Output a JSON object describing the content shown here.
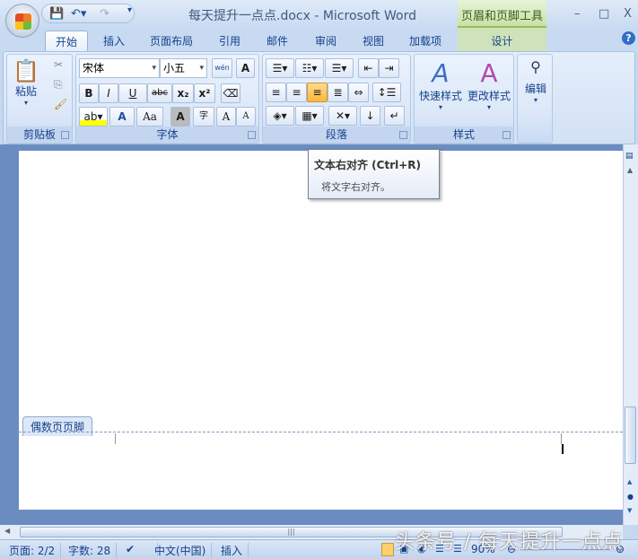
{
  "window": {
    "title": "每天提升一点点.docx - Microsoft Word",
    "context_title": "页眉和页脚工具",
    "minimize": "–",
    "maximize": "□",
    "close": "X"
  },
  "tabs": [
    "开始",
    "插入",
    "页面布局",
    "引用",
    "邮件",
    "审阅",
    "视图",
    "加载项"
  ],
  "context_tab": "设计",
  "help": "?",
  "ribbon": {
    "clipboard": {
      "label": "剪贴板",
      "paste": "粘贴"
    },
    "font": {
      "label": "字体",
      "font_name": "宋体",
      "font_size": "小五",
      "bold": "B",
      "italic": "I",
      "underline": "U",
      "strike": "abc",
      "sub": "x₂",
      "sup": "x²",
      "grow": "A",
      "shrink": "A",
      "case": "Aa",
      "shade": "A",
      "enclose": "字",
      "phonetic": "wén",
      "border": "A",
      "color": "A"
    },
    "paragraph": {
      "label": "段落"
    },
    "styles": {
      "label": "样式",
      "quick": "快速样式",
      "change": "更改样式"
    },
    "editing": {
      "label": "编辑"
    }
  },
  "tooltip": {
    "title": "文本右对齐 (Ctrl+R)",
    "body": "将文字右对齐。"
  },
  "document": {
    "footer_label": "偶数页页脚"
  },
  "status": {
    "page": "页面: 2/2",
    "words": "字数: 28",
    "language": "中文(中国)",
    "mode": "插入",
    "zoom": "90%"
  },
  "watermark": "头条号 / 每天提升一点点"
}
